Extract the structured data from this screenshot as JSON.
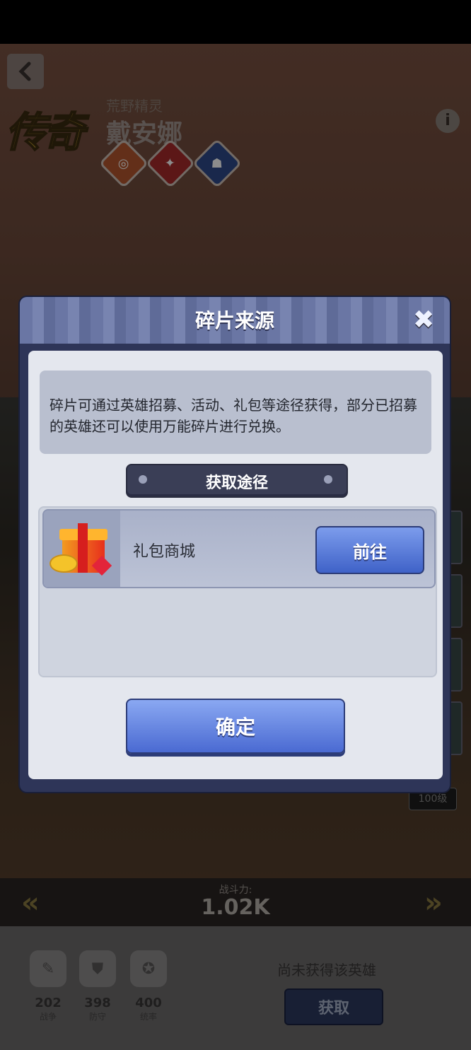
{
  "hero": {
    "rarity": "传奇",
    "subtitle": "荒野精灵",
    "name": "戴安娜"
  },
  "power": {
    "label": "战斗力:",
    "value": "1.02K"
  },
  "stats": [
    {
      "value": "202",
      "label": "战争",
      "icon": "sword-icon"
    },
    {
      "value": "398",
      "label": "防守",
      "icon": "shield-icon"
    },
    {
      "value": "400",
      "label": "统率",
      "icon": "star-icon"
    }
  ],
  "status": {
    "unowned_text": "尚未获得该英雄",
    "obtain_label": "获取"
  },
  "level_box": "100级",
  "modal": {
    "title": "碎片来源",
    "description": "碎片可通过英雄招募、活动、礼包等途径获得，部分已招募的英雄还可以使用万能碎片进行兑换。",
    "route_header": "获取途径",
    "routes": [
      {
        "name": "礼包商城",
        "button": "前往",
        "icon": "gift-box-icon"
      }
    ],
    "confirm_label": "确定"
  },
  "colors": {
    "modal_frame": "#2e3558",
    "button_blue": "#4a6ad2",
    "rarity_gold": "#b0902a"
  }
}
